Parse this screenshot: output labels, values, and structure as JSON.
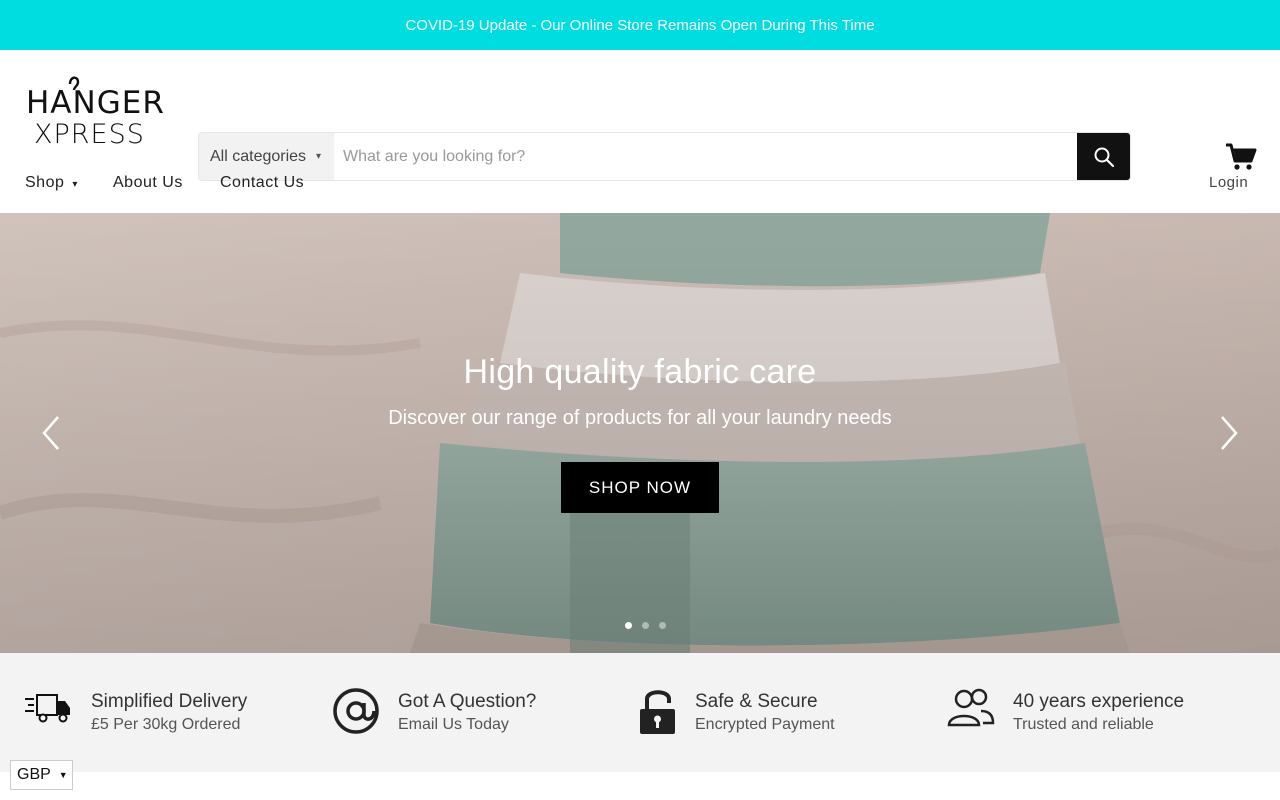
{
  "announcement": {
    "text": "COVID-19 Update - Our Online Store Remains Open During This Time"
  },
  "header": {
    "logo": {
      "line1": "HANGER",
      "line2": "XPRESS"
    },
    "search": {
      "category": "All categories",
      "placeholder": "What are you looking for?"
    },
    "cart_icon": "cart-icon"
  },
  "nav": {
    "shop": "Shop",
    "about": "About Us",
    "contact": "Contact Us",
    "login": "Login"
  },
  "hero": {
    "title": "High quality fabric care",
    "subtitle": "Discover our range of products for all your laundry needs",
    "cta": "SHOP NOW",
    "slides": 3,
    "active_slide": 1
  },
  "features": [
    {
      "icon": "delivery-truck-icon",
      "title": "Simplified Delivery",
      "subtitle": "£5 Per 30kg Ordered"
    },
    {
      "icon": "at-sign-icon",
      "title": "Got A Question?",
      "subtitle": "Email Us Today"
    },
    {
      "icon": "lock-icon",
      "title": "Safe & Secure",
      "subtitle": "Encrypted Payment"
    },
    {
      "icon": "users-icon",
      "title": "40 years experience",
      "subtitle": "Trusted and reliable"
    }
  ],
  "currency": {
    "value": "GBP"
  },
  "colors": {
    "announcement_bg": "#00dde0",
    "cta_bg": "#000000",
    "search_button_bg": "#111111"
  }
}
